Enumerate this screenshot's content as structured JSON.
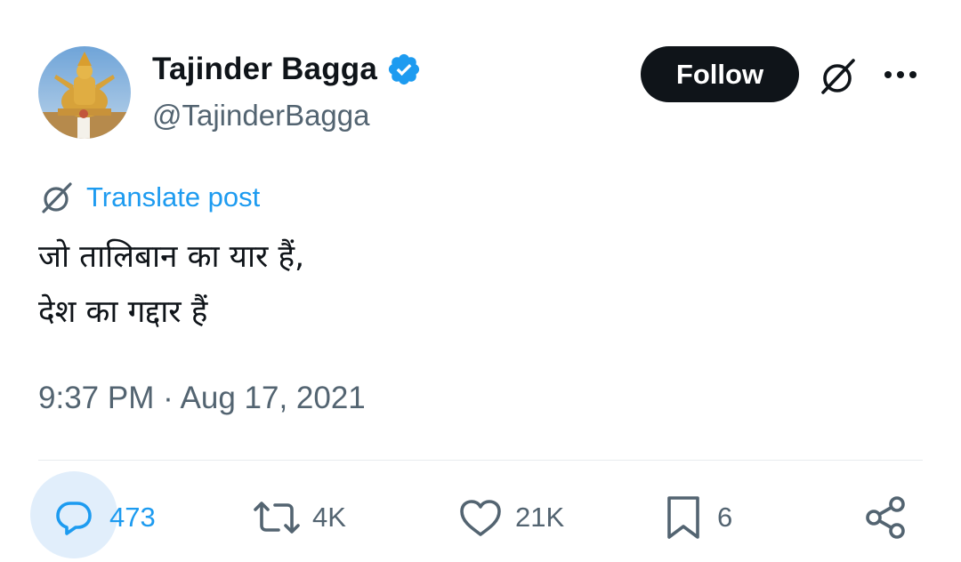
{
  "author": {
    "display_name": "Tajinder Bagga",
    "handle": "@TajinderBagga",
    "verified": true,
    "avatar": "statue-photo-avatar"
  },
  "header": {
    "follow_label": "Follow",
    "grok_icon": "grok-icon",
    "more_icon": "more-dots-icon"
  },
  "translate": {
    "label": "Translate post",
    "icon": "grok-icon"
  },
  "post": {
    "lines": [
      "जो तालिबान का यार हैं,",
      "देश का गद्दार हैं"
    ]
  },
  "timestamp": "9:37 PM · Aug 17, 2021",
  "actions": {
    "replies": "473",
    "reposts": "4K",
    "likes": "21K",
    "bookmarks": "6",
    "share_icon": "share-icon"
  },
  "colors": {
    "accent": "#1d9bf0",
    "text_primary": "#0f1419",
    "text_secondary": "#536471",
    "reply_highlight": "#e1eefb",
    "follow_bg": "#0f1419"
  }
}
